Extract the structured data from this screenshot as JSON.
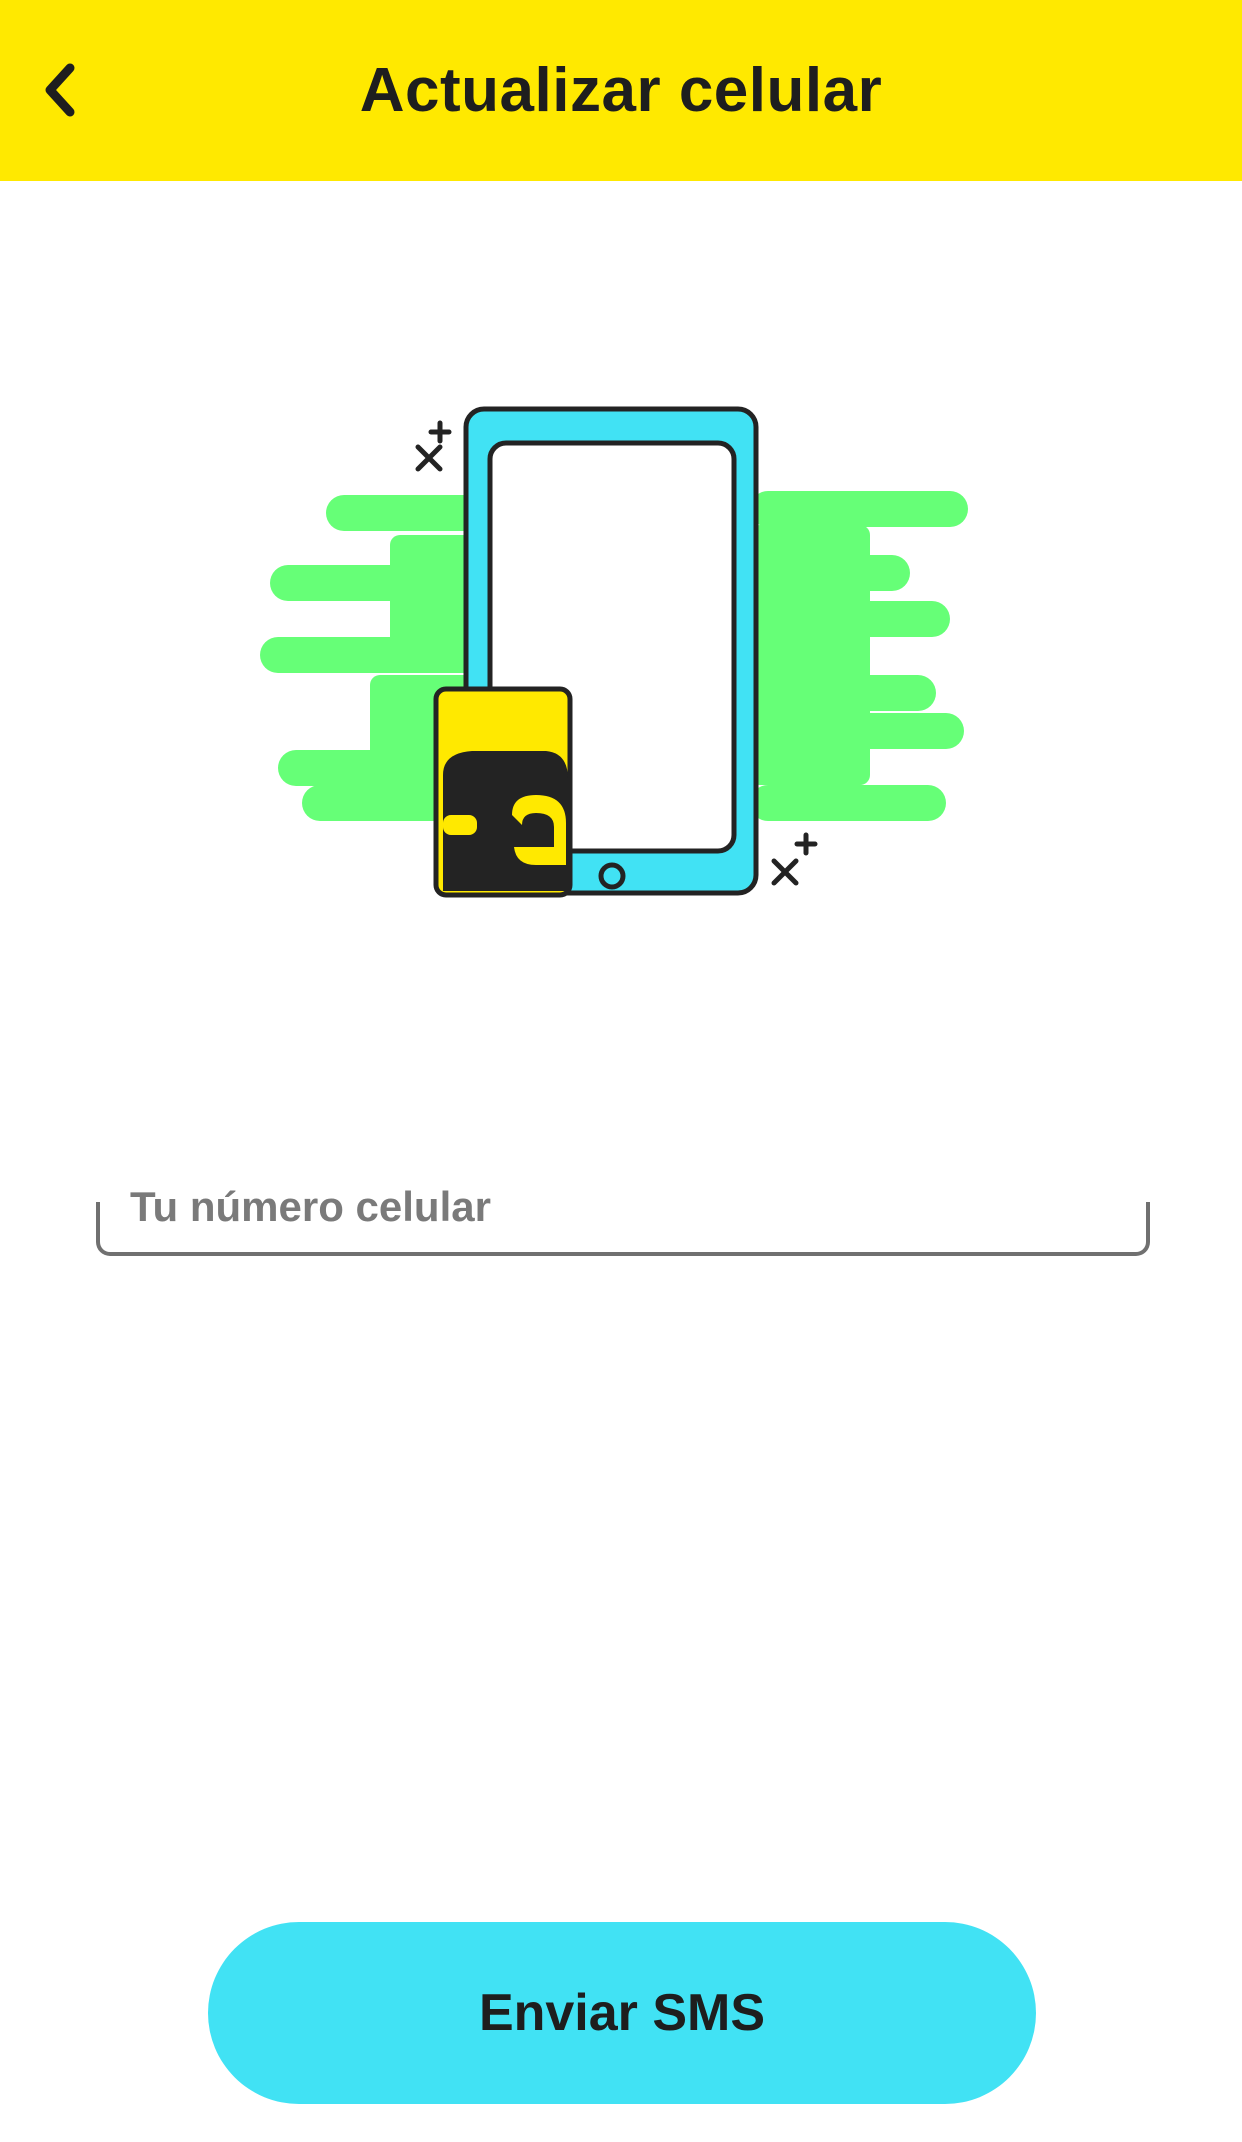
{
  "header": {
    "title": "Actualizar celular",
    "back_icon": "chevron-left-icon",
    "background_color": "#FFE900"
  },
  "illustration": {
    "subject": "phone-with-sim-card-illustration",
    "colors": {
      "speed_lines": "#66FF77",
      "phone_body": "#41E2F4",
      "sim_card_top": "#FFE900",
      "sim_card_logo": "#232323",
      "outline": "#232323"
    }
  },
  "phone_input": {
    "value": "",
    "placeholder": "Tu número celular"
  },
  "submit": {
    "label": "Enviar SMS",
    "background_color": "#41E2F4"
  }
}
